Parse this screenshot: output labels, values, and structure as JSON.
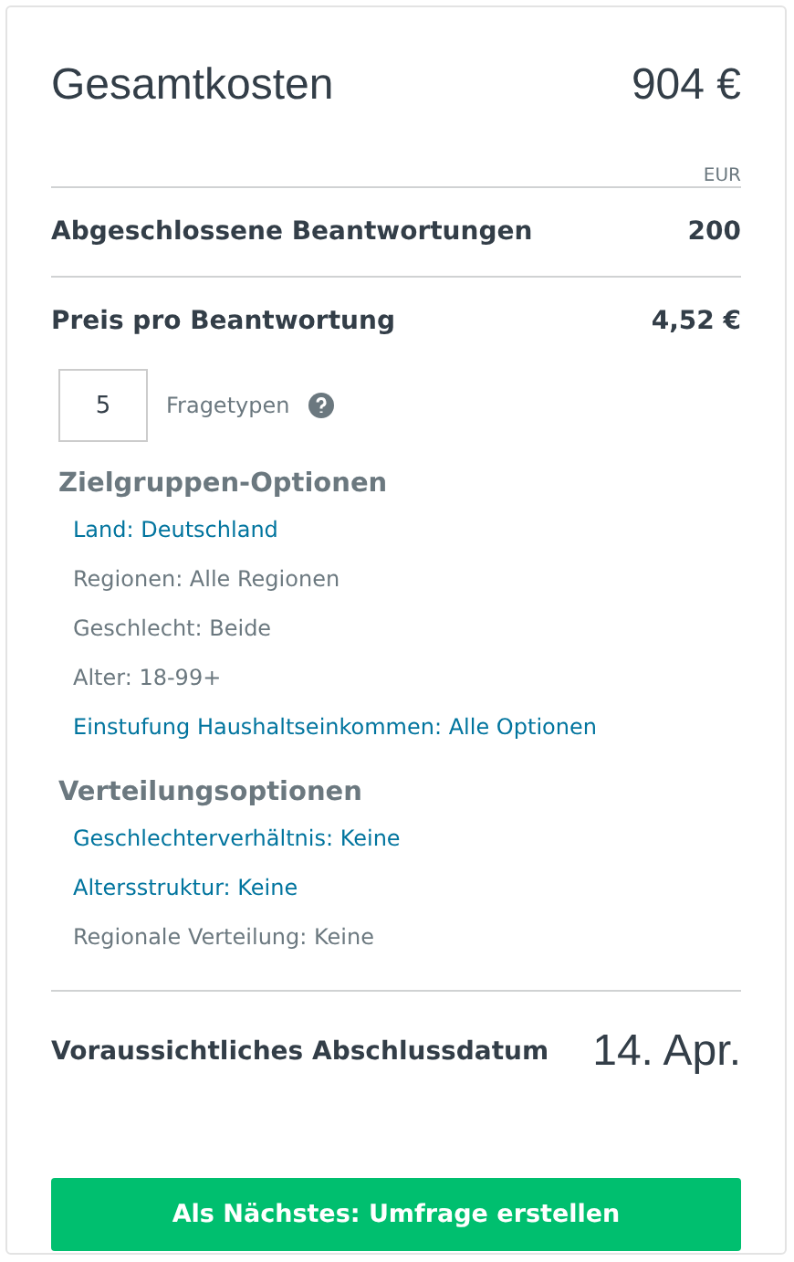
{
  "total": {
    "label": "Gesamtkosten",
    "amount": "904 €",
    "currency": "EUR"
  },
  "rows": [
    {
      "label": "Abgeschlossene Beantwortungen",
      "value": "200"
    },
    {
      "label": "Preis pro Beantwortung",
      "value": "4,52 €"
    }
  ],
  "question_types": {
    "value": "5",
    "label": "Fragetypen"
  },
  "sections": [
    {
      "title": "Zielgruppen-Optionen",
      "items": [
        {
          "text": "Land: Deutschland",
          "kind": "link"
        },
        {
          "text": "Regionen: Alle Regionen",
          "kind": "text"
        },
        {
          "text": "Geschlecht: Beide",
          "kind": "text"
        },
        {
          "text": "Alter: 18-99+",
          "kind": "text"
        },
        {
          "text": "Einstufung Haushaltseinkommen: Alle Optionen",
          "kind": "link"
        }
      ]
    },
    {
      "title": "Verteilungsoptionen",
      "items": [
        {
          "text": "Geschlechterverhältnis: Keine",
          "kind": "link"
        },
        {
          "text": "Altersstruktur: Keine",
          "kind": "link"
        },
        {
          "text": "Regionale Verteilung: Keine",
          "kind": "text"
        }
      ]
    }
  ],
  "completion": {
    "label": "Voraussichtliches Abschlussdatum",
    "date": "14. Apr."
  },
  "button": "Als Nächstes: Umfrage erstellen"
}
